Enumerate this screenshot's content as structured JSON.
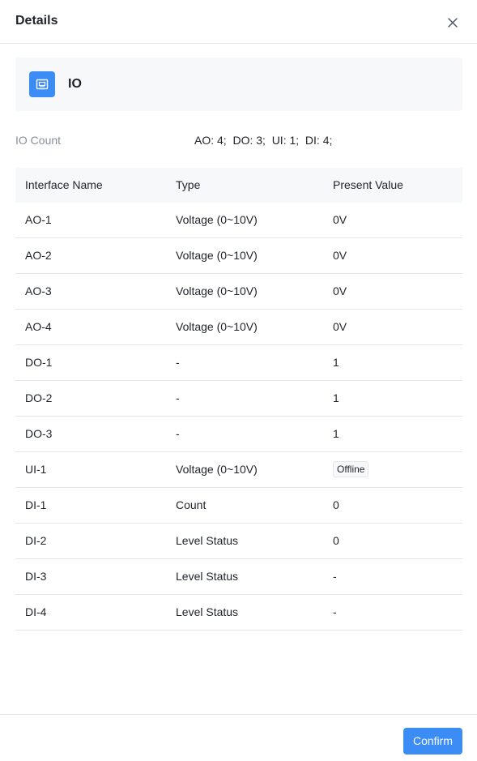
{
  "drawer": {
    "title": "Details",
    "close_icon": "close-icon"
  },
  "device": {
    "icon": "io-module-icon",
    "name": "IO"
  },
  "io_count": {
    "label": "IO Count",
    "value": "AO: 4;  DO: 3;  UI: 1;  DI: 4;"
  },
  "table": {
    "columns": [
      "Interface Name",
      "Type",
      "Present Value"
    ],
    "rows": [
      {
        "name": "AO-1",
        "type": "Voltage (0~10V)",
        "value": "0V"
      },
      {
        "name": "AO-2",
        "type": "Voltage (0~10V)",
        "value": "0V"
      },
      {
        "name": "AO-3",
        "type": "Voltage (0~10V)",
        "value": "0V"
      },
      {
        "name": "AO-4",
        "type": "Voltage (0~10V)",
        "value": "0V"
      },
      {
        "name": "DO-1",
        "type": "-",
        "value": "1"
      },
      {
        "name": "DO-2",
        "type": "-",
        "value": "1"
      },
      {
        "name": "DO-3",
        "type": "-",
        "value": "1"
      },
      {
        "name": "UI-1",
        "type": "Voltage (0~10V)",
        "value": "Offline",
        "value_is_badge": true
      },
      {
        "name": "DI-1",
        "type": "Count",
        "value": "0"
      },
      {
        "name": "DI-2",
        "type": "Level Status",
        "value": "0"
      },
      {
        "name": "DI-3",
        "type": "Level Status",
        "value": "-"
      },
      {
        "name": "DI-4",
        "type": "Level Status",
        "value": "-"
      }
    ]
  },
  "footer": {
    "confirm_label": "Confirm"
  },
  "colors": {
    "primary": "#3b8cf5",
    "border": "#e5e6eb",
    "muted_text": "#86909c",
    "panel_bg": "#f7f8fa"
  }
}
